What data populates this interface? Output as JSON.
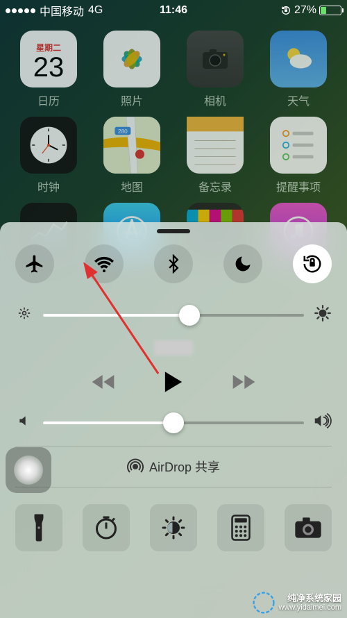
{
  "status": {
    "carrier": "中国移动",
    "network": "4G",
    "time": "11:46",
    "battery": "27%"
  },
  "apps": {
    "calendar": {
      "label": "日历",
      "weekday": "星期二",
      "day": "23"
    },
    "photos": {
      "label": "照片"
    },
    "camera": {
      "label": "相机"
    },
    "weather": {
      "label": "天气"
    },
    "clock": {
      "label": "时钟"
    },
    "maps": {
      "label": "地图"
    },
    "notes": {
      "label": "备忘录"
    },
    "reminders": {
      "label": "提醒事项"
    },
    "stocks": {
      "label": ""
    },
    "appstore": {
      "label": ""
    },
    "videos": {
      "label": ""
    },
    "itunes": {
      "label": ""
    }
  },
  "cc": {
    "airplane": false,
    "wifi": false,
    "bluetooth": false,
    "dnd": false,
    "lock": true,
    "brightness_pct": 56,
    "volume_pct": 50,
    "now_playing": "",
    "airdrop_label": "AirDrop 共享"
  },
  "watermark": {
    "brand": "纯净系统家园",
    "url": "www.yidaimei.com"
  }
}
